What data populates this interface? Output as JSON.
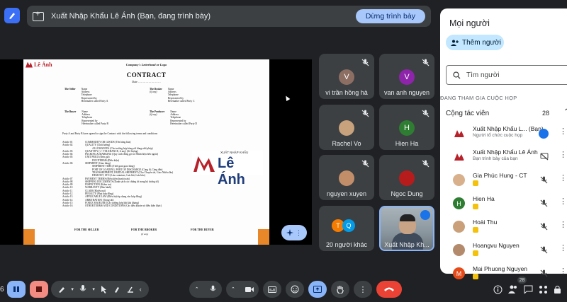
{
  "presentation": {
    "banner_text": "Xuất Nhập Khẩu Lê Ánh (Bạn, đang trình bày)",
    "stop_label": "Dừng trình bày"
  },
  "document": {
    "logo_text": "Lê Ánh",
    "letterhead": "Company's Letterhead or Logo",
    "title": "CONTRACT",
    "date_line": "Date ……………………",
    "seller": [
      "The Seller",
      "Name",
      "Address",
      "Telephone",
      "Represented by",
      "Hereinafter called Party A"
    ],
    "broker": [
      "The Broker",
      "(if any)",
      "Name",
      "Address",
      "Telephone",
      "Represented by",
      "Hereinafter called Party C"
    ],
    "buyer": [
      "The Buyer",
      "Name",
      "Address",
      "Telephone",
      "Represented by",
      "Hereinafter called Party B"
    ],
    "producer": [
      "The Producer",
      "(if any)",
      "Name",
      "Address",
      "Telephone",
      "Represented by",
      "Hereinafter called Party D"
    ],
    "agreement": "Party A and Party B have agreed to sign the Contract with the following terms and conditions",
    "articles": [
      [
        "Article 01",
        "COMMODITY OR GOODS (Tên hàng hóa)"
      ],
      [
        "Article 02",
        "QUALITY (Chất lượng)"
      ],
      [
        "",
        "ALLOWANCES (Cho trường hợp hàng rời hàng nhờ phép)"
      ],
      [
        "Article 03",
        "QUANTITY (+/- TOLERANCE, if any) (Số lượng)"
      ],
      [
        "Article 04",
        "PACKING & MARKING (Quy cách đóng gói và Nhãn hiệu bên ngoài)"
      ],
      [
        "Article 05",
        "UNIT PRICE (Đơn giá)"
      ],
      [
        "",
        "INCOTERMS (Điều kiện)"
      ],
      [
        "Article 06",
        "SHIPMENT (Giao hàng)"
      ],
      [
        "",
        "SHIPMENT TIME (Thời gian giao hàng)"
      ],
      [
        "",
        "PORT OF LOADING, PORT OF DISCHARGE (Cảng đi, Cảng đến)"
      ],
      [
        "",
        "TRANSSHIPMENT, PARTIAL SHIPMENT (Cho Chuyển tải, Giao Nhiều lần)"
      ],
      [
        "",
        "DEM-DET, STO (Lưu container, Lưu bãi, Lưu kho)"
      ],
      [
        "Article 07",
        "PAYMENT TERMS (Điều kiện thanh toán)"
      ],
      [
        "Article 08",
        "SHIPPING DOCUMENTS (Danh sách các chứng từ trong bộ chứng từ)"
      ],
      [
        "Article 09",
        "INSPECTION (Kiểm tra)"
      ],
      [
        "Article 10",
        "WARRANTY (Bảo hành)"
      ],
      [
        "Article 11",
        "CLAIM (Khiếu nại)"
      ],
      [
        "Article 12",
        "PENALTY (Phạt hợp đồng)"
      ],
      [
        "Article 13",
        "APPLICABLE LAW (Điều luật áp dụng vào hợp đồng)"
      ],
      [
        "Article 14",
        "ARBITRATION (Trọng tài)"
      ],
      [
        "Article 15",
        "FORCE MAJEURE (Các trường hợp bất khả kháng)"
      ],
      [
        "Article 16",
        "OTHER TERMS AND CONDITIONS (Các điều khoản và điều kiện khác)"
      ]
    ],
    "big_logo_small": "XUẤT NHẬP KHẨU",
    "big_logo_name": "Lê Ánh",
    "sig_seller": "FOR THE SELLER",
    "sig_broker": "FOR THE BROKER",
    "sig_broker_sub": "(if any)",
    "sig_buyer": "FOR THE BUYER"
  },
  "tiles": [
    {
      "initial": "V",
      "name": "vi trần hồng hà",
      "color": "#8d6e63"
    },
    {
      "initial": "V",
      "name": "van anh nguyen",
      "color": "#8e24aa"
    },
    {
      "initial": "",
      "name": "Rachel Vo",
      "color": "#c7a27c"
    },
    {
      "initial": "H",
      "name": "Hien Ha",
      "color": "#2e7d32"
    },
    {
      "initial": "",
      "name": "nguyen xuyen",
      "color": "#c28e6a"
    },
    {
      "initial": "",
      "name": "Ngoc Dung",
      "color": "#b71c1c"
    },
    {
      "initials": [
        "T",
        "Q"
      ],
      "name": "20 người khác",
      "colors": [
        "#f57c00",
        "#039be5"
      ]
    },
    {
      "name": "Xuất Nhập Kh..."
    }
  ],
  "panel": {
    "title": "Mọi người",
    "add_label": "Thêm người",
    "search_placeholder": "Tìm người",
    "section": "ĐANG THAM GIA CUỘC HỌP",
    "group": "Cộng tác viên",
    "count": "28",
    "people": [
      {
        "name": "Xuất Nhập Khẩu L... (Bạn)",
        "sub": "Người tổ chức cuộc họp",
        "color": "#fff"
      },
      {
        "name": "Xuất Nhập Khẩu Lê Ánh",
        "sub": "Bạn trình bày của bạn",
        "color": "#fff"
      },
      {
        "name": "Gia Phúc Hung - CT",
        "sub": "",
        "color": "#d8b08c"
      },
      {
        "name": "Hien Ha",
        "sub": "",
        "initial": "H",
        "color": "#2e7d32"
      },
      {
        "name": "Hoài Thu",
        "sub": "",
        "color": "#c9a07a"
      },
      {
        "name": "Hoangvu Nguyen",
        "sub": "",
        "color": "#b48a6c"
      },
      {
        "name": "Mai Phuong Nguyen",
        "sub": "",
        "initial": "M",
        "color": "#e64a19"
      }
    ]
  },
  "toolbar": {
    "participants_count": "28",
    "left_number": "6"
  }
}
